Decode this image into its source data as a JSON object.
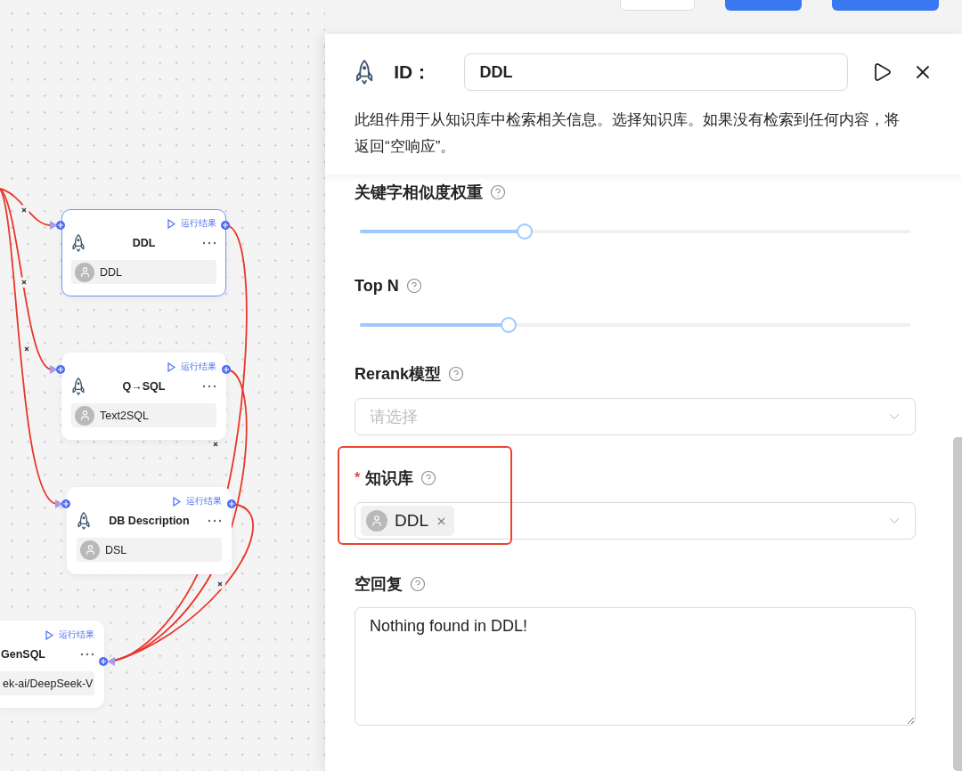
{
  "toolbar": {
    "buttons": [
      {
        "kind": "outline"
      },
      {
        "kind": "primary"
      },
      {
        "kind": "primary"
      }
    ]
  },
  "canvas": {
    "nodes": [
      {
        "title": "DDL",
        "run_label": "运行结果",
        "param": "DDL",
        "selected": true,
        "clipped": false
      },
      {
        "title": "Q→SQL",
        "run_label": "运行结果",
        "param": "Text2SQL",
        "selected": false,
        "clipped": false
      },
      {
        "title": "DB Description",
        "run_label": "运行结果",
        "param": "DSL",
        "selected": false,
        "clipped": false
      },
      {
        "title": "GenSQL",
        "run_label": "运行结果",
        "param": "ek-ai/DeepSeek-V",
        "selected": false,
        "clipped": true
      }
    ]
  },
  "panel": {
    "id_label": "ID：",
    "id_value": "DDL",
    "description": "此组件用于从知识库中检索相关信息。选择知识库。如果没有检索到任何内容，将返回“空响应”。",
    "fields": [
      {
        "kind": "slider",
        "label": "关键字相似度权重",
        "level": 0.3
      },
      {
        "kind": "slider",
        "label": "Top N",
        "level": 0.27
      },
      {
        "kind": "select",
        "label": "Rerank模型",
        "placeholder": "请选择"
      },
      {
        "kind": "tags",
        "label": "知识库",
        "required_mark": "*",
        "tags": [
          "DDL"
        ],
        "highlighted": true
      },
      {
        "kind": "textarea",
        "label": "空回复",
        "value": "Nothing found in DDL!"
      }
    ]
  }
}
